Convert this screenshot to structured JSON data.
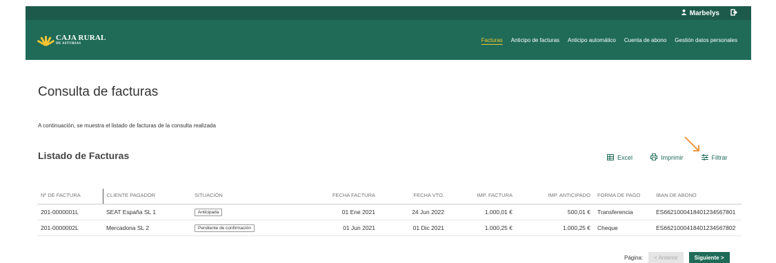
{
  "topbar": {
    "user_name": "Marbelys"
  },
  "header": {
    "logo_line1": "CAJA RURAL",
    "logo_line2": "DE ASTURIAS",
    "nav": [
      "Facturas",
      "Anticipo de facturas",
      "Anticipo automático",
      "Cuenta de abono",
      "Gestión datos personales"
    ]
  },
  "page": {
    "title": "Consulta de facturas",
    "subtitle": "A continuación, se muestra el listado de facturas de la consulta realizada",
    "list_title": "Listado de Facturas"
  },
  "actions": {
    "excel": "Excel",
    "print": "Imprimir",
    "filter": "Filtrar"
  },
  "table": {
    "headers": [
      "Nº DE FACTURA",
      "CLIENTE PAGADOR",
      "SITUACIÓN",
      "FECHA FACTURA",
      "FECHA VTO.",
      "IMP. FACTURA",
      "IMP. ANTICIPADO",
      "FORMA DE PAGO",
      "IBAN DE ABONO"
    ],
    "rows": [
      {
        "num": "201-0000001L",
        "cliente": "SEAT España SL 1",
        "situacion": "Anticipada",
        "fecha": "01 Ene 2021",
        "vto": "24 Jun 2022",
        "imp": "1.000,01 €",
        "anticipado": "500,01 €",
        "forma": "Transferencia",
        "iban": "ES6621000418401234567801"
      },
      {
        "num": "201-0000002L",
        "cliente": "Mercadona SL 2",
        "situacion": "Pendiente de confirmación",
        "fecha": "01 Jun 2021",
        "vto": "01 Dic 2021",
        "imp": "1.000,25 €",
        "anticipado": "1.000,25 €",
        "forma": "Cheque",
        "iban": "ES6621000418401234567802"
      }
    ]
  },
  "pager": {
    "label": "Página:",
    "prev": "< Anterior",
    "next": "Siguiente >"
  },
  "colors": {
    "header": "#1f6b58",
    "accent": "#f4c430",
    "arrow": "#f08a2c"
  }
}
